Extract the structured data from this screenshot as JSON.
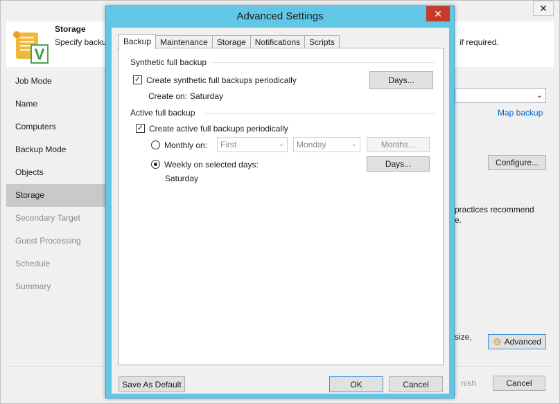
{
  "wizard": {
    "close_glyph": "✕",
    "header": {
      "title": "Storage",
      "description": "Specify backu",
      "description_tail": "if required.",
      "icon": "scroll-checkmark-icon"
    },
    "nav": [
      {
        "label": "Job Mode",
        "state": "normal"
      },
      {
        "label": "Name",
        "state": "normal"
      },
      {
        "label": "Computers",
        "state": "normal"
      },
      {
        "label": "Backup Mode",
        "state": "normal"
      },
      {
        "label": "Objects",
        "state": "normal"
      },
      {
        "label": "Storage",
        "state": "active"
      },
      {
        "label": "Secondary Target",
        "state": "disabled"
      },
      {
        "label": "Guest Processing",
        "state": "disabled"
      },
      {
        "label": "Schedule",
        "state": "disabled"
      },
      {
        "label": "Summary",
        "state": "disabled"
      }
    ],
    "map_backup_link": "Map backup",
    "configure_label": "Configure...",
    "practices_line1": "practices recommend",
    "practices_line2": "e.",
    "size_text": "size,",
    "advanced_label": "Advanced",
    "finish_label": "nish",
    "cancel_label": "Cancel"
  },
  "dialog": {
    "title": "Advanced Settings",
    "close_glyph": "✕",
    "tabs": [
      {
        "label": "Backup",
        "active": true
      },
      {
        "label": "Maintenance",
        "active": false
      },
      {
        "label": "Storage",
        "active": false
      },
      {
        "label": "Notifications",
        "active": false
      },
      {
        "label": "Scripts",
        "active": false
      }
    ],
    "synthetic": {
      "group_label": "Synthetic full backup",
      "checkbox_label": "Create synthetic full backups periodically",
      "checked": true,
      "create_on_label": "Create on:",
      "create_on_value": "Saturday",
      "days_button": "Days..."
    },
    "active_full": {
      "group_label": "Active full backup",
      "checkbox_label": "Create active full backups periodically",
      "checked": true,
      "monthly_label": "Monthly on:",
      "monthly_selected": false,
      "monthly_week": "First",
      "monthly_day": "Monday",
      "months_button": "Months...",
      "weekly_label": "Weekly on selected days:",
      "weekly_selected": true,
      "weekly_value": "Saturday",
      "days_button": "Days..."
    },
    "footer": {
      "save_default": "Save As Default",
      "ok": "OK",
      "cancel": "Cancel"
    },
    "colors": {
      "frame": "#62c6e6",
      "close_button": "#c7392b"
    }
  }
}
